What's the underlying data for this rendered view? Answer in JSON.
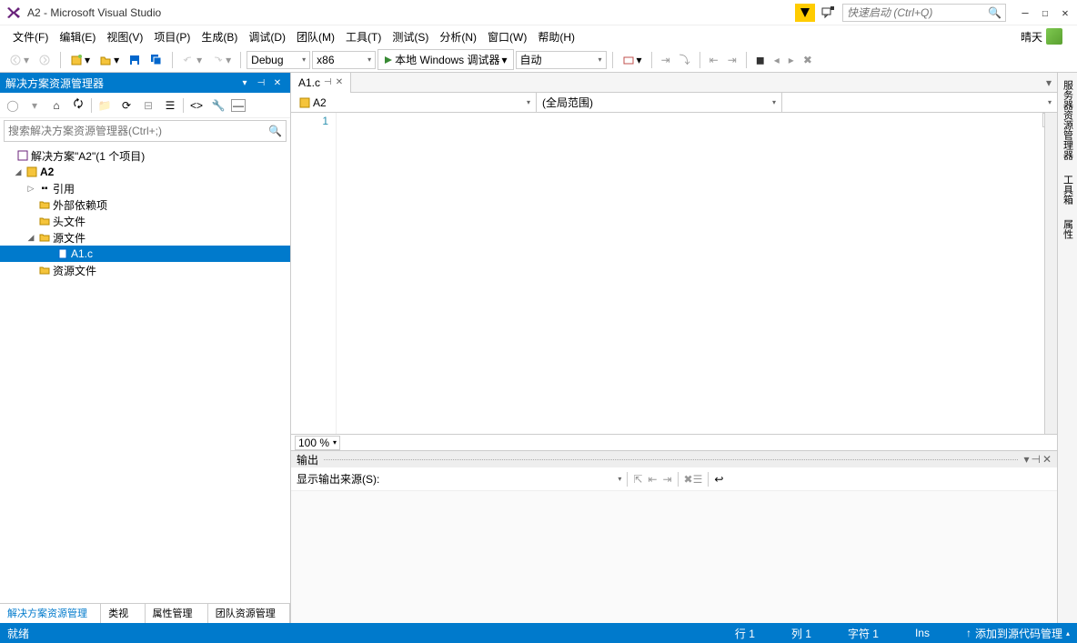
{
  "title": "A2 - Microsoft Visual Studio",
  "quicklaunch_placeholder": "快速启动 (Ctrl+Q)",
  "menu": [
    "文件(F)",
    "编辑(E)",
    "视图(V)",
    "项目(P)",
    "生成(B)",
    "调试(D)",
    "团队(M)",
    "工具(T)",
    "测试(S)",
    "分析(N)",
    "窗口(W)",
    "帮助(H)"
  ],
  "weather": "晴天",
  "toolbar": {
    "config": "Debug",
    "platform": "x86",
    "run_label": "本地 Windows 调试器",
    "thread_mode": "自动"
  },
  "solution_explorer": {
    "title": "解决方案资源管理器",
    "search_placeholder": "搜索解决方案资源管理器(Ctrl+;)",
    "root": "解决方案\"A2\"(1 个项目)",
    "project": "A2",
    "nodes": {
      "references": "引用",
      "external": "外部依赖项",
      "headers": "头文件",
      "sources": "源文件",
      "resources": "资源文件"
    },
    "file": "A1.c",
    "bottom_tabs": [
      "解决方案资源管理器",
      "类视图",
      "属性管理器",
      "团队资源管理器"
    ]
  },
  "editor": {
    "tab": "A1.c",
    "nav_project": "A2",
    "nav_scope": "(全局范围)",
    "line1": "1",
    "zoom": "100 %"
  },
  "output": {
    "title": "输出",
    "source_label": "显示输出来源(S):"
  },
  "right_tabs": [
    "服务器资源管理器",
    "工具箱",
    "属性"
  ],
  "status": {
    "ready": "就绪",
    "line": "行 1",
    "col": "列 1",
    "char": "字符 1",
    "ins": "Ins",
    "scm": "添加到源代码管理"
  }
}
